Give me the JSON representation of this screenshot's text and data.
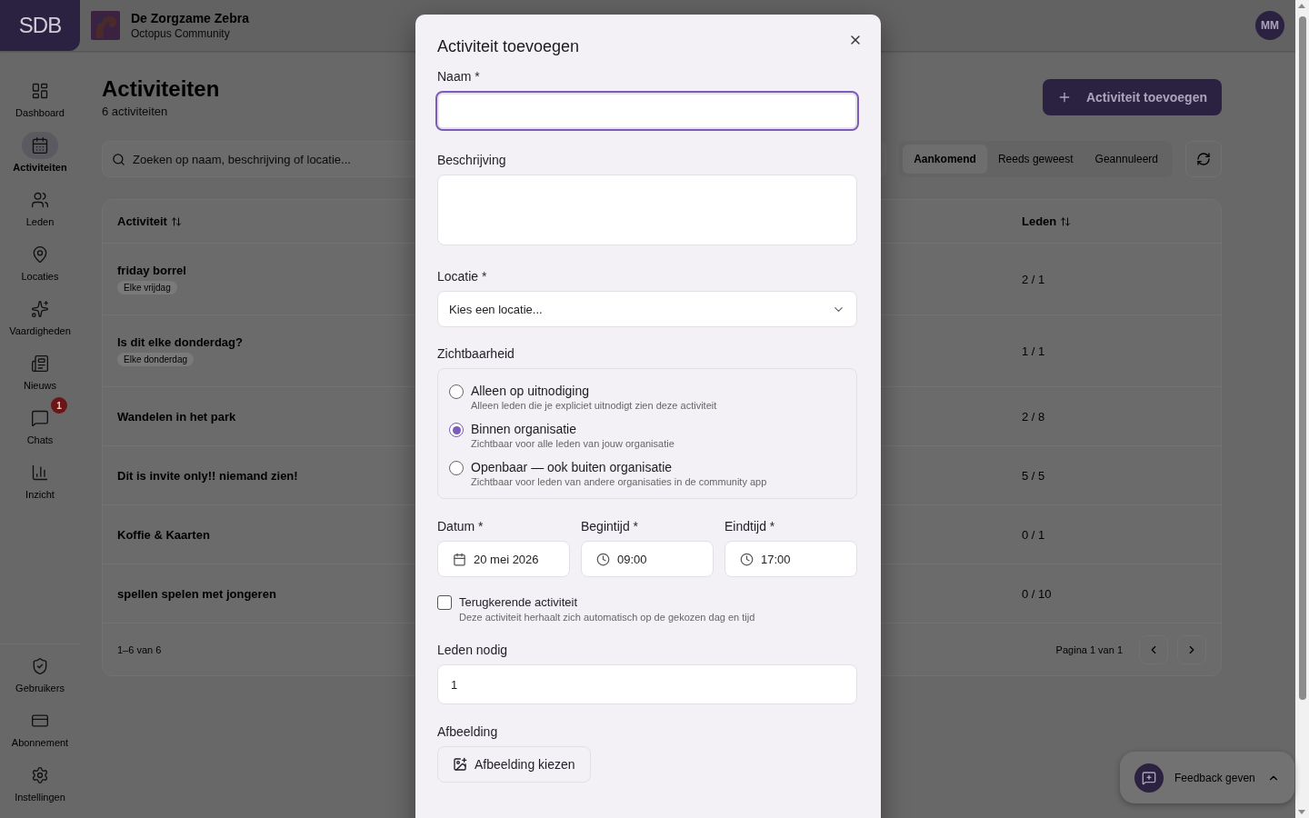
{
  "header": {
    "logo": "SDB",
    "org_name": "De Zorgzame Zebra",
    "org_subtitle": "Octopus Community",
    "avatar": "MM"
  },
  "sidebar": {
    "items": [
      {
        "label": "Dashboard",
        "selected": false
      },
      {
        "label": "Activiteiten",
        "selected": true
      },
      {
        "label": "Leden",
        "selected": false
      },
      {
        "label": "Locaties",
        "selected": false
      },
      {
        "label": "Vaardigheden",
        "selected": false
      },
      {
        "label": "Nieuws",
        "selected": false
      },
      {
        "label": "Chats",
        "selected": false,
        "badge": "1"
      },
      {
        "label": "Inzicht",
        "selected": false
      }
    ],
    "bottom_items": [
      {
        "label": "Gebruikers",
        "selected": false
      },
      {
        "label": "Abonnement",
        "selected": false
      },
      {
        "label": "Instellingen",
        "selected": false
      }
    ]
  },
  "page": {
    "title": "Activiteiten",
    "subtitle": "6 activiteiten",
    "add_button": "Activiteit toevoegen",
    "search": {
      "placeholder": "Zoeken op naam, beschrijving of locatie..."
    },
    "filters": [
      {
        "label": "Aankomend",
        "selected": true
      },
      {
        "label": "Reeds geweest",
        "selected": false
      },
      {
        "label": "Geannuleerd",
        "selected": false
      }
    ]
  },
  "table": {
    "columns": [
      "Activiteit",
      "Leden"
    ],
    "rows": [
      {
        "name": "friday borrel",
        "tag": "Elke vrijdag",
        "members": "2 / 1"
      },
      {
        "name": "Is dit elke donderdag?",
        "tag": "Elke donderdag",
        "members": "1 / 1"
      },
      {
        "name": "Wandelen in het park",
        "members": "2 / 8"
      },
      {
        "name": "Dit is invite only!! niemand zien!",
        "members": "5 / 5"
      },
      {
        "name": "Koffie & Kaarten",
        "members": "0 / 1"
      },
      {
        "name": "spellen spelen met jongeren",
        "members": "0 / 10"
      }
    ],
    "range": "1–6 van 6",
    "page_label": "Pagina 1 van 1"
  },
  "feedback": {
    "label": "Feedback geven"
  },
  "dialog": {
    "title": "Activiteit toevoegen",
    "name": {
      "label": "Naam *",
      "focused": true
    },
    "description": {
      "label": "Beschrijving"
    },
    "location": {
      "label": "Locatie *",
      "placeholder": "Kies een locatie..."
    },
    "visibility": {
      "label": "Zichtbaarheid",
      "options": [
        {
          "title": "Alleen op uitnodiging",
          "description": "Alleen leden die je expliciet uitnodigt zien deze activiteit",
          "selected": false
        },
        {
          "title": "Binnen organisatie",
          "description": "Zichtbaar voor alle leden van jouw organisatie",
          "selected": true
        },
        {
          "title": "Openbaar — ook buiten organisatie",
          "description": "Zichtbaar voor leden van andere organisaties in de community app",
          "selected": false
        }
      ]
    },
    "schedule": [
      {
        "label": "Datum *",
        "value": "20 mei 2026",
        "kind": "date"
      },
      {
        "label": "Begintijd *",
        "value": "09:00",
        "kind": "time"
      },
      {
        "label": "Eindtijd *",
        "value": "17:00",
        "kind": "time"
      }
    ],
    "recurring": {
      "label": "Terugkerende activiteit",
      "hint": "Deze activiteit herhaalt zich automatisch op de gekozen dag en tijd",
      "checked": false
    },
    "members_needed": {
      "label": "Leden nodig",
      "value": "1"
    },
    "image": {
      "label": "Afbeelding",
      "button": "Afbeelding kiezen"
    }
  }
}
